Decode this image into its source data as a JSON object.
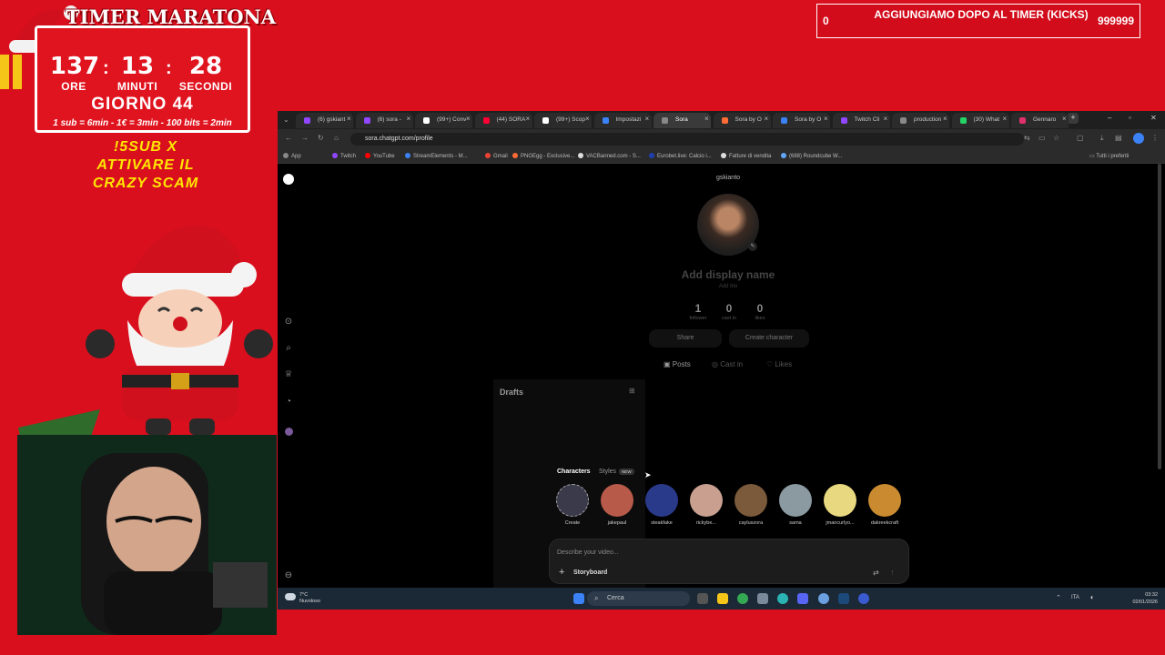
{
  "overlay": {
    "timer_title": "TIMER MARATONA",
    "hours": "137",
    "minutes": "13",
    "seconds": "28",
    "hours_label": "ORE",
    "minutes_label": "MINUTI",
    "seconds_label": "SECONDI",
    "day": "GIORNO 44",
    "rates": "1 sub = 6min - 1€ = 3min - 100 bits = 2min",
    "promo_line1": "!5SUB X",
    "promo_line2": "ATTIVARE IL",
    "promo_line3": "CRAZY SCAM",
    "goal_current": "0",
    "goal_text": "AGGIUNGIAMO DOPO AL TIMER (KICKS)",
    "goal_target": "999999"
  },
  "browser": {
    "tabs": [
      {
        "label": "(6) gskiant",
        "color": "#9146ff"
      },
      {
        "label": "(6) sora -",
        "color": "#9146ff"
      },
      {
        "label": "(99+) Conv",
        "color": "#ffffff"
      },
      {
        "label": "(44) SORA",
        "color": "#ff0033"
      },
      {
        "label": "(99+) Scop",
        "color": "#ffffff"
      },
      {
        "label": "Impostazi",
        "color": "#3b82f6"
      },
      {
        "label": "Sora",
        "color": "#888888"
      },
      {
        "label": "Sora by O",
        "color": "#ff6b35"
      },
      {
        "label": "Sora by O",
        "color": "#3b82f6"
      },
      {
        "label": "Twitch Cli",
        "color": "#9146ff"
      },
      {
        "label": "production",
        "color": "#888888"
      },
      {
        "label": "(30) What",
        "color": "#25d366"
      },
      {
        "label": "Gennaro",
        "color": "#e1306c"
      }
    ],
    "active_tab_index": 6,
    "url": "sora.chatgpt.com/profile",
    "bookmarks": [
      {
        "label": "App",
        "color": "#888888"
      },
      {
        "label": "Twitch",
        "color": "#9146ff"
      },
      {
        "label": "YouTube",
        "color": "#ff0000"
      },
      {
        "label": "StreamElements - M...",
        "color": "#3b82f6"
      },
      {
        "label": "Gmail",
        "color": "#ea4335"
      },
      {
        "label": "PNGEgg - Exclusive...",
        "color": "#ff6b35"
      },
      {
        "label": "VACBanned.com - S...",
        "color": "#dddddd"
      },
      {
        "label": "Eurobet.live: Calcio i...",
        "color": "#1e40af"
      },
      {
        "label": "Fatture di vendita",
        "color": "#dddddd"
      },
      {
        "label": "(688) Roundcube W...",
        "color": "#60a5fa"
      }
    ],
    "bookmarks_right": "Tutti i preferiti"
  },
  "profile": {
    "username": "gskianto",
    "display_name_placeholder": "Add display name",
    "add_bio": "Add bio",
    "followers": "1",
    "followers_label": "follower",
    "cast_in": "0",
    "cast_in_label": "cast in",
    "likes": "0",
    "likes_label": "likes",
    "share_label": "Share",
    "create_character_label": "Create character",
    "tab_posts": "Posts",
    "tab_cast_in": "Cast in",
    "tab_likes": "Likes"
  },
  "drafts": {
    "title": "Drafts"
  },
  "composer": {
    "tab_characters": "Characters",
    "tab_styles": "Styles",
    "new_badge": "NEW",
    "characters": [
      {
        "name": "Create",
        "color": "#3a3a4a"
      },
      {
        "name": "jakepaul",
        "color": "#b85a4a"
      },
      {
        "name": "steakfake",
        "color": "#2a3a8a"
      },
      {
        "name": "rickybe...",
        "color": "#c9a090"
      },
      {
        "name": "cayluszora",
        "color": "#7a5a3a"
      },
      {
        "name": "sama",
        "color": "#8a9aa0"
      },
      {
        "name": "jmancurlyo...",
        "color": "#e8d880"
      },
      {
        "name": "dakreekcraft",
        "color": "#c98a30"
      }
    ],
    "placeholder": "Describe your video...",
    "storyboard_label": "Storyboard"
  },
  "taskbar": {
    "weather_temp": "7°C",
    "weather_desc": "Nuvoloso",
    "search_label": "Cerca",
    "lang": "ITA",
    "time": "03:32",
    "date": "02/01/2026"
  }
}
